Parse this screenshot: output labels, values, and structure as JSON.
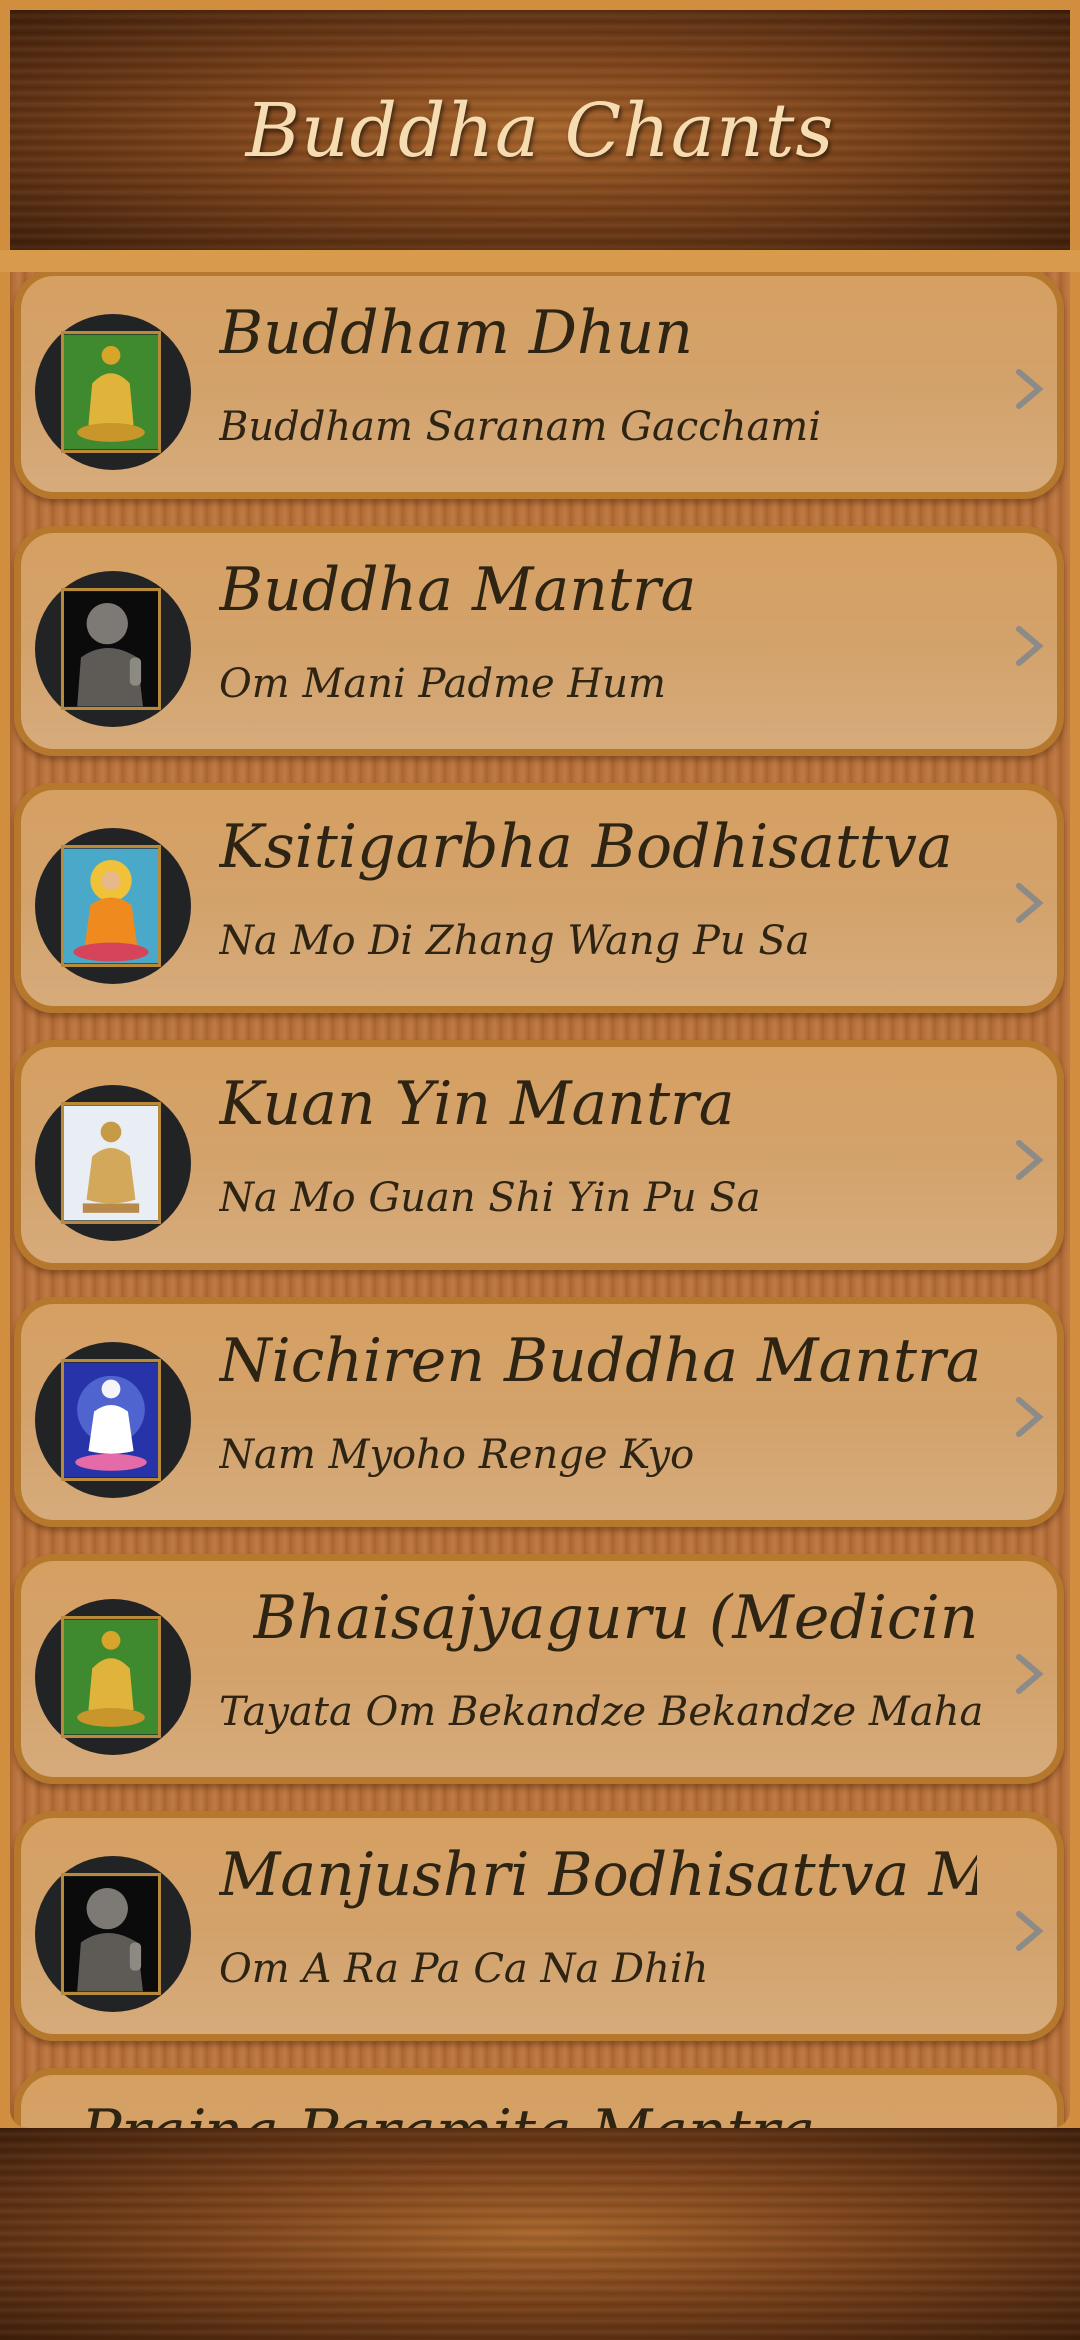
{
  "header": {
    "title": "Buddha Chants"
  },
  "items": [
    {
      "title": "Buddham Dhun",
      "subtitle": "Buddham Saranam Gacchami",
      "thumb": "golden-buddha-green"
    },
    {
      "title": "Buddha Mantra",
      "subtitle": "Om Mani Padme Hum",
      "thumb": "stone-buddha-dark"
    },
    {
      "title": "Ksitigarbha Bodhisattva",
      "subtitle": "Na Mo Di Zhang Wang Pu Sa",
      "thumb": "buddha-orange-robe"
    },
    {
      "title": "Kuan Yin Mantra",
      "subtitle": "Na Mo Guan Shi Yin Pu Sa",
      "thumb": "golden-buddha-sky"
    },
    {
      "title": "Nichiren Buddha Mantra",
      "subtitle": "Nam Myoho Renge Kyo",
      "thumb": "white-buddha-blue"
    },
    {
      "title": "Bhaisajyaguru (Medicine...",
      "subtitle": "Tayata Om Bekandze Bekandze Maha...",
      "thumb": "golden-buddha-green"
    },
    {
      "title": "Manjushri Bodhisattva Ma...",
      "subtitle": "Om A Ra Pa Ca Na Dhih",
      "thumb": "stone-buddha-dark"
    },
    {
      "title": "Prajna Paramita Mantra",
      "subtitle": "",
      "thumb": "golden-buddha-sky"
    }
  ],
  "icons": {
    "row_chevron": "chevron-right-icon"
  },
  "colors": {
    "row_fill": "#d6a062",
    "row_border": "#b6782d",
    "text": "#2e2414",
    "header_text": "#f6dcb1"
  }
}
